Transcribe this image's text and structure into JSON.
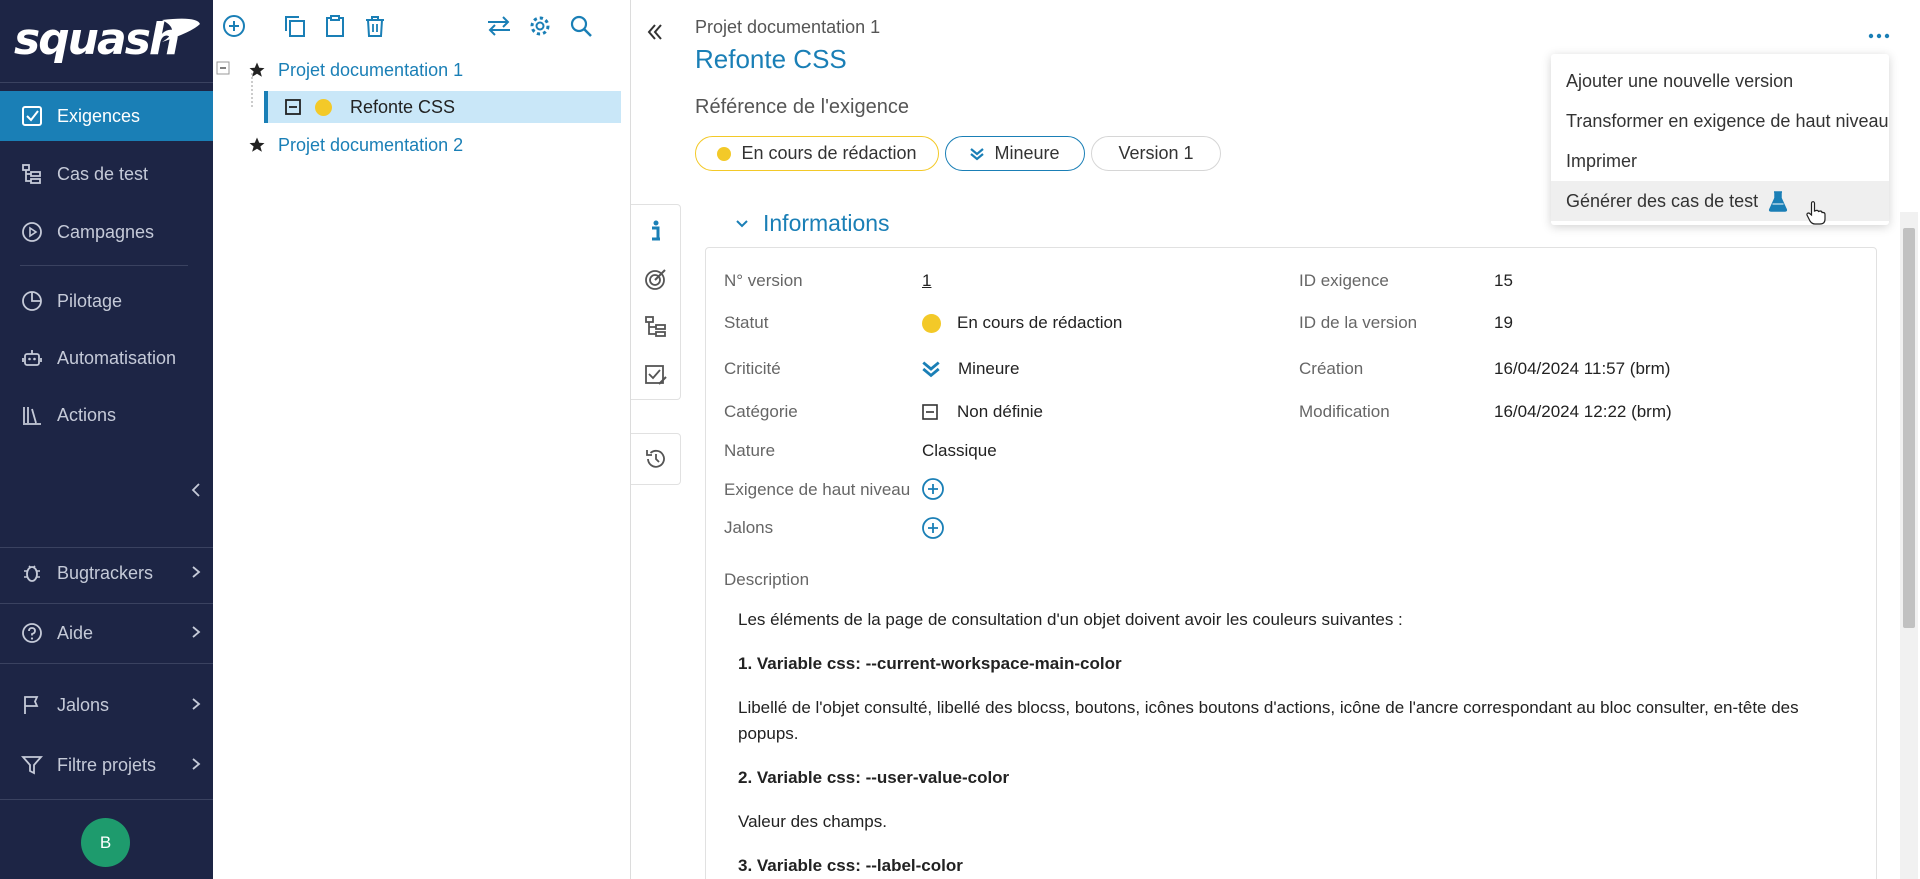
{
  "app": {
    "logo": "squash"
  },
  "nav": {
    "items": [
      {
        "label": "Exigences",
        "icon": "requirements-icon",
        "active": true
      },
      {
        "label": "Cas de test",
        "icon": "test-case-icon"
      },
      {
        "label": "Campagnes",
        "icon": "campaign-icon"
      },
      {
        "label": "Pilotage",
        "icon": "pie-chart-icon"
      },
      {
        "label": "Automatisation",
        "icon": "robot-icon"
      },
      {
        "label": "Actions",
        "icon": "library-icon"
      }
    ],
    "bottom_items": [
      {
        "label": "Bugtrackers",
        "icon": "bug-icon"
      },
      {
        "label": "Aide",
        "icon": "help-icon"
      },
      {
        "label": "Jalons",
        "icon": "flag-icon"
      },
      {
        "label": "Filtre projets",
        "icon": "filter-icon"
      }
    ],
    "avatar": "B"
  },
  "tree": {
    "nodes": [
      {
        "label": "Projet documentation 1"
      },
      {
        "label": "Refonte CSS"
      },
      {
        "label": "Projet documentation 2"
      }
    ]
  },
  "header": {
    "breadcrumb": "Projet documentation 1",
    "title": "Refonte CSS",
    "reference_label": "Référence de l'exigence",
    "pills": {
      "status": "En cours de rédaction",
      "criticality": "Mineure",
      "version": "Version 1"
    }
  },
  "section": {
    "title": "Informations",
    "fields_left": [
      {
        "label": "N° version",
        "value": "1"
      },
      {
        "label": "Statut",
        "value": "En cours de rédaction"
      },
      {
        "label": "Criticité",
        "value": "Mineure"
      },
      {
        "label": "Catégorie",
        "value": "Non définie"
      },
      {
        "label": "Nature",
        "value": "Classique"
      },
      {
        "label": "Exigence de haut niveau",
        "value": ""
      },
      {
        "label": "Jalons",
        "value": ""
      }
    ],
    "fields_right": [
      {
        "label": "ID exigence",
        "value": "15"
      },
      {
        "label": "ID de la version",
        "value": "19"
      },
      {
        "label": "Création",
        "value": "16/04/2024 11:57 (brm)"
      },
      {
        "label": "Modification",
        "value": "16/04/2024 12:22 (brm)"
      }
    ],
    "description_label": "Description",
    "description": {
      "intro": "Les éléments de la page de consultation d'un objet doivent avoir les couleurs suivantes :",
      "h1": "1. Variable css: --current-workspace-main-color",
      "p1": "Libellé de l'objet consulté,  libellé des blocss, boutons, icônes boutons d'actions, icône de l'ancre correspondant au bloc consulter, en-tête des popups.",
      "h2": "2. Variable css: --user-value-color",
      "p2": "Valeur des champs.",
      "h3": "3. Variable css: --label-color"
    }
  },
  "menu": {
    "items": [
      "Ajouter une nouvelle version",
      "Transformer en exigence de haut niveau",
      "Imprimer",
      "Générer des cas de test"
    ]
  },
  "colors": {
    "nav_bg": "#1d2545",
    "accent": "#1a7fb6",
    "status_yellow": "#f3c928",
    "selection_bg": "#c9e7f8",
    "avatar_green": "#1e9b6d"
  }
}
